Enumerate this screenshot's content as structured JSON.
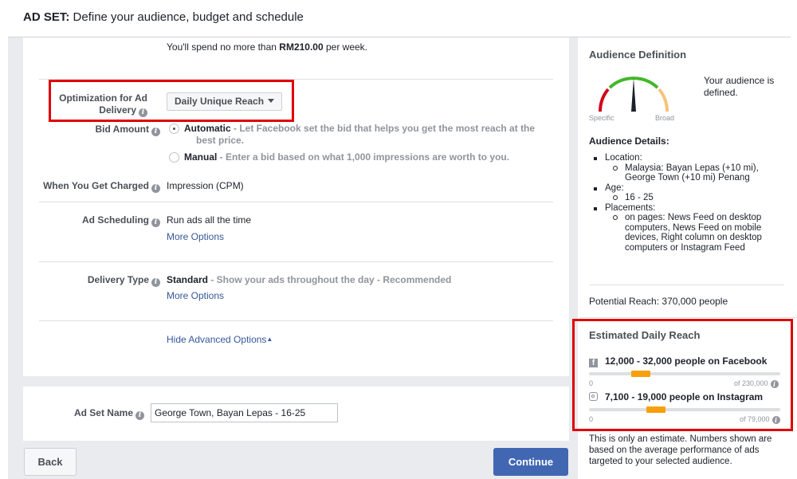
{
  "header": {
    "title_bold": "AD SET:",
    "title_rest": "Define your audience, budget and schedule"
  },
  "budget": {
    "spend_prefix": "You'll spend no more than ",
    "spend_amount": "RM210.00",
    "spend_suffix": " per week."
  },
  "optimization": {
    "label_line1": "Optimization for Ad",
    "label_line2": "Delivery",
    "selected": "Daily Unique Reach"
  },
  "bid": {
    "label": "Bid Amount",
    "automatic_title": "Automatic",
    "automatic_desc": " - Let Facebook set the bid that helps you get the most reach at the",
    "automatic_desc2": "best price.",
    "manual_title": "Manual",
    "manual_desc": " - Enter a bid based on what 1,000 impressions are worth to you.",
    "selected": "Automatic"
  },
  "charged": {
    "label": "When You Get Charged",
    "value": "Impression (CPM)"
  },
  "scheduling": {
    "label": "Ad Scheduling",
    "value": "Run ads all the time",
    "more": "More Options"
  },
  "delivery": {
    "label": "Delivery Type",
    "value_bold": "Standard",
    "value_desc": " - Show your ads throughout the day - Recommended",
    "more": "More Options"
  },
  "advanced": {
    "toggle": "Hide Advanced Options"
  },
  "adset_name": {
    "label": "Ad Set Name",
    "value": "George Town, Bayan Lepas - 16-25"
  },
  "buttons": {
    "back": "Back",
    "continue": "Continue"
  },
  "audience_definition": {
    "title": "Audience Definition",
    "status_line1": "Your audience is",
    "status_line2": "defined.",
    "gauge_left": "Specific",
    "gauge_right": "Broad"
  },
  "audience_details": {
    "title": "Audience Details:",
    "location_label": "Location:",
    "location_line1": "Malaysia: Bayan Lepas (+10 mi),",
    "location_line2": "George Town (+10 mi) Penang",
    "age_label": "Age:",
    "age_value": "16 - 25",
    "placements_label": "Placements:",
    "placements_line1": "on pages: News Feed on desktop",
    "placements_line2": "computers, News Feed on mobile",
    "placements_line3": "devices, Right column on desktop",
    "placements_line4": "computers or Instagram Feed"
  },
  "potential_reach": "Potential Reach: 370,000 people",
  "estimated_reach": {
    "title": "Estimated Daily Reach",
    "facebook": {
      "range": "12,000 - 32,000 people on Facebook",
      "min": "0",
      "max": "of 230,000",
      "low_fraction": 0.22,
      "high_fraction": 0.32
    },
    "instagram": {
      "range": "7,100 - 19,000 people on Instagram",
      "min": "0",
      "max": "of 79,000",
      "low_fraction": 0.3,
      "high_fraction": 0.4
    }
  },
  "estimate_note": {
    "line1": "This is only an estimate. Numbers shown are",
    "line2": "based on the average performance of ads",
    "line3": "targeted to your selected audience."
  },
  "colors": {
    "accent": "#4267b2",
    "highlight": "#e00000",
    "reach_bar": "#f7a00b",
    "gauge_green": "#42b72a",
    "gauge_red": "#d0021b",
    "gauge_orange": "#f7a00b"
  },
  "icons": {
    "info": "info-icon",
    "facebook": "facebook-icon",
    "instagram": "instagram-icon",
    "caret": "caret-down-icon"
  }
}
